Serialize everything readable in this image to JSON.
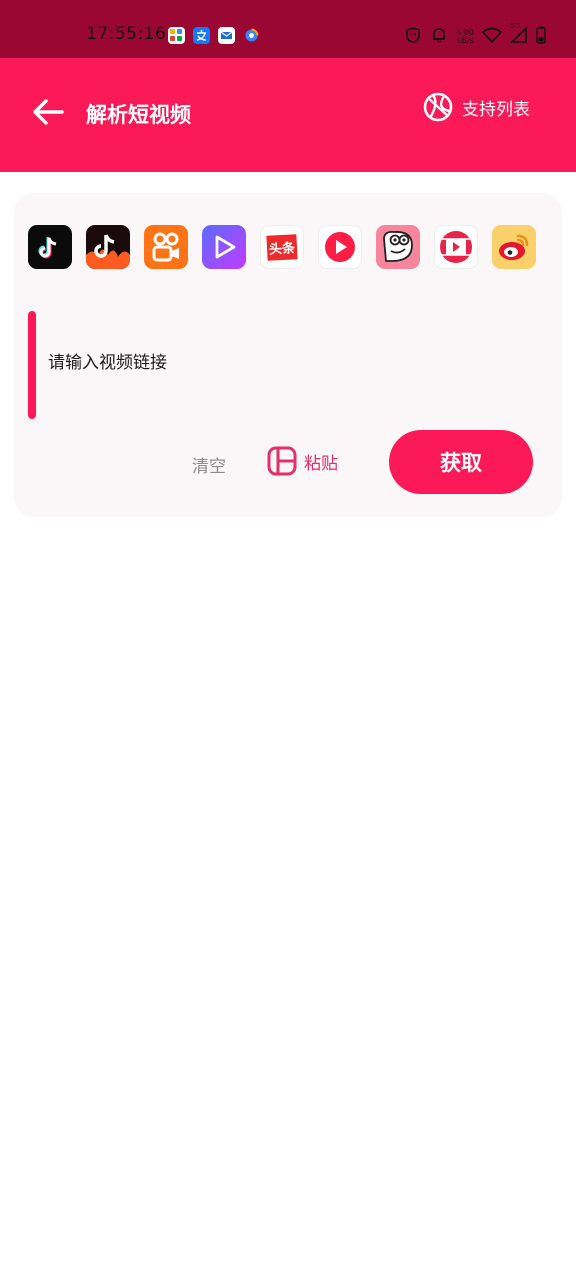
{
  "status_bar": {
    "time": "17:55:16",
    "net_speed_value": "4.00",
    "net_speed_unit": "KB/s",
    "network_badge": "5G",
    "background_color": "#9b0733"
  },
  "header": {
    "title": "解析短视频",
    "back_icon": "arrow-left-icon",
    "support_icon": "basketball-icon",
    "support_label": "支持列表",
    "background_color": "#fb1a57"
  },
  "platforms": [
    {
      "name": "tiktok",
      "icon": "tiktok-icon"
    },
    {
      "name": "douyin-huoshan",
      "icon": "douyin-fire-icon"
    },
    {
      "name": "kuaishou",
      "icon": "kuaishou-icon"
    },
    {
      "name": "video-play",
      "icon": "play-gradient-icon"
    },
    {
      "name": "toutiao",
      "icon": "toutiao-icon",
      "label": "头条"
    },
    {
      "name": "xigua",
      "icon": "xigua-icon"
    },
    {
      "name": "pipixia",
      "icon": "pipixia-icon"
    },
    {
      "name": "kuai-video",
      "icon": "tv-play-icon"
    },
    {
      "name": "weibo",
      "icon": "weibo-icon"
    }
  ],
  "input": {
    "placeholder": "请输入视频链接",
    "value": ""
  },
  "actions": {
    "clear_label": "清空",
    "paste_label": "粘贴",
    "paste_icon": "clipboard-layout-icon",
    "fetch_label": "获取",
    "accent_color": "#fb1a57"
  }
}
